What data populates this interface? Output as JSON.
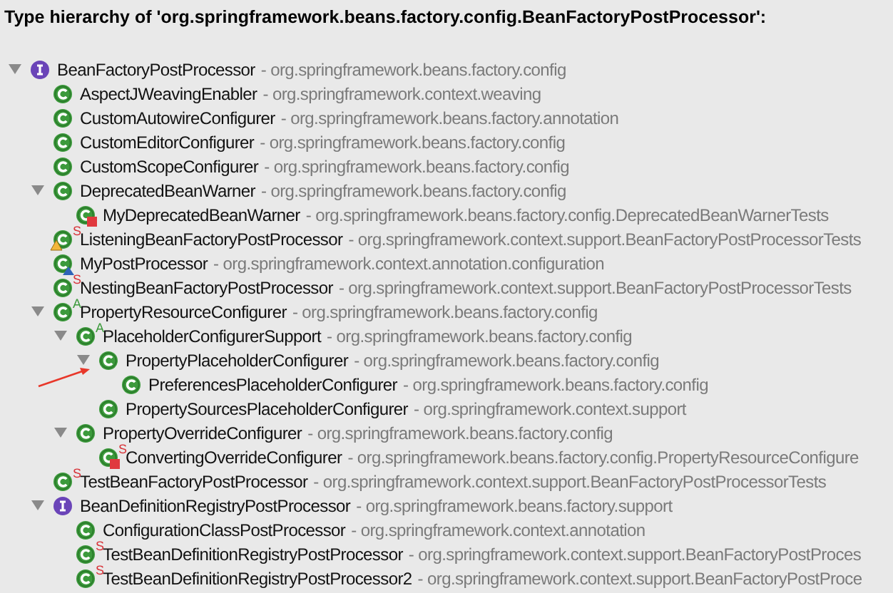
{
  "title": "Type hierarchy of 'org.springframework.beans.factory.config.BeanFactoryPostProcessor':",
  "tree": [
    {
      "name": "BeanFactoryPostProcessor",
      "detail": "- org.springframework.beans.factory.config",
      "kind": "interface",
      "expanded": true,
      "children": [
        {
          "name": "AspectJWeavingEnabler",
          "detail": "- org.springframework.context.weaving",
          "kind": "class"
        },
        {
          "name": "CustomAutowireConfigurer",
          "detail": "- org.springframework.beans.factory.annotation",
          "kind": "class"
        },
        {
          "name": "CustomEditorConfigurer",
          "detail": "- org.springframework.beans.factory.config",
          "kind": "class"
        },
        {
          "name": "CustomScopeConfigurer",
          "detail": "- org.springframework.beans.factory.config",
          "kind": "class"
        },
        {
          "name": "DeprecatedBeanWarner",
          "detail": "- org.springframework.beans.factory.config",
          "kind": "class",
          "expanded": true,
          "children": [
            {
              "name": "MyDeprecatedBeanWarner",
              "detail": "- org.springframework.beans.factory.config.DeprecatedBeanWarnerTests",
              "kind": "class",
              "red_mark": true
            }
          ]
        },
        {
          "name": "ListeningBeanFactoryPostProcessor",
          "detail": "- org.springframework.context.support.BeanFactoryPostProcessorTests",
          "kind": "class",
          "badge": "S",
          "warning": true
        },
        {
          "name": "MyPostProcessor",
          "detail": "- org.springframework.context.annotation.configuration",
          "kind": "class",
          "blue_mark": true
        },
        {
          "name": "NestingBeanFactoryPostProcessor",
          "detail": "- org.springframework.context.support.BeanFactoryPostProcessorTests",
          "kind": "class",
          "badge": "S"
        },
        {
          "name": "PropertyResourceConfigurer",
          "detail": "- org.springframework.beans.factory.config",
          "kind": "class",
          "badge": "A",
          "expanded": true,
          "children": [
            {
              "name": "PlaceholderConfigurerSupport",
              "detail": "- org.springframework.beans.factory.config",
              "kind": "class",
              "badge": "A",
              "expanded": true,
              "children": [
                {
                  "name": "PropertyPlaceholderConfigurer",
                  "detail": "- org.springframework.beans.factory.config",
                  "kind": "class",
                  "expanded": true,
                  "children": [
                    {
                      "name": "PreferencesPlaceholderConfigurer",
                      "detail": "- org.springframework.beans.factory.config",
                      "kind": "class"
                    }
                  ]
                },
                {
                  "name": "PropertySourcesPlaceholderConfigurer",
                  "detail": "- org.springframework.context.support",
                  "kind": "class"
                }
              ]
            },
            {
              "name": "PropertyOverrideConfigurer",
              "detail": "- org.springframework.beans.factory.config",
              "kind": "class",
              "expanded": true,
              "children": [
                {
                  "name": "ConvertingOverrideConfigurer",
                  "detail": "- org.springframework.beans.factory.config.PropertyResourceConfigure",
                  "kind": "class",
                  "badge": "S",
                  "red_mark": true
                }
              ]
            }
          ]
        },
        {
          "name": "TestBeanFactoryPostProcessor",
          "detail": "- org.springframework.context.support.BeanFactoryPostProcessorTests",
          "kind": "class",
          "badge": "S"
        },
        {
          "name": "BeanDefinitionRegistryPostProcessor",
          "detail": "- org.springframework.beans.factory.support",
          "kind": "interface",
          "expanded": true,
          "children": [
            {
              "name": "ConfigurationClassPostProcessor",
              "detail": "- org.springframework.context.annotation",
              "kind": "class"
            },
            {
              "name": "TestBeanDefinitionRegistryPostProcessor",
              "detail": "- org.springframework.context.support.BeanFactoryPostProces",
              "kind": "class",
              "badge": "S"
            },
            {
              "name": "TestBeanDefinitionRegistryPostProcessor2",
              "detail": "- org.springframework.context.support.BeanFactoryPostProce",
              "kind": "class",
              "badge": "S"
            }
          ]
        }
      ]
    }
  ]
}
